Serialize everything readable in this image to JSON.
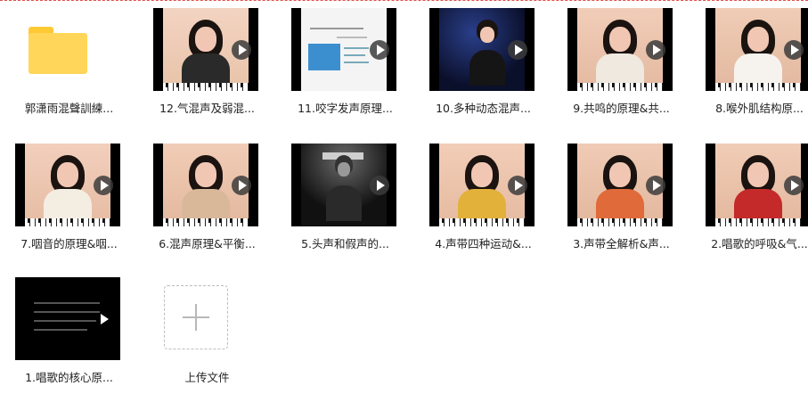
{
  "items": [
    {
      "label": "郭潇雨混聲訓練...",
      "type": "folder"
    },
    {
      "label": "12.气混声及弱混...",
      "type": "video"
    },
    {
      "label": "11.咬字发声原理...",
      "type": "video"
    },
    {
      "label": "10.多种动态混声...",
      "type": "video"
    },
    {
      "label": "9.共鸣的原理&共...",
      "type": "video"
    },
    {
      "label": "8.喉外肌结构原...",
      "type": "video"
    },
    {
      "label": "7.咽音的原理&咽...",
      "type": "video"
    },
    {
      "label": "6.混声原理&平衡...",
      "type": "video"
    },
    {
      "label": "5.头声和假声的...",
      "type": "video"
    },
    {
      "label": "4.声带四种运动&...",
      "type": "video"
    },
    {
      "label": "3.声带全解析&声...",
      "type": "video"
    },
    {
      "label": "2.唱歌的呼吸&气...",
      "type": "video"
    },
    {
      "label": "1.唱歌的核心原...",
      "type": "video"
    },
    {
      "label": "上传文件",
      "type": "upload"
    }
  ],
  "colors": {
    "folder": "#ffd65a",
    "border_top": "#e0504a",
    "text": "#222222"
  },
  "icons": {
    "folder": "folder-icon",
    "play": "play-icon",
    "upload": "plus-icon"
  }
}
